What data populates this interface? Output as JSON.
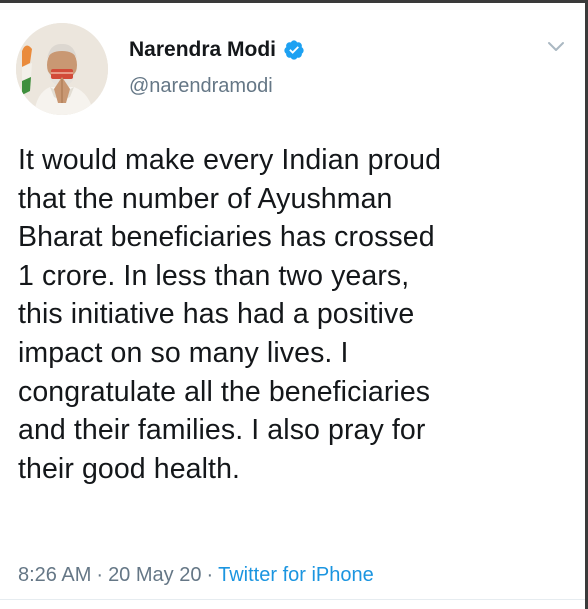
{
  "tweet": {
    "author": {
      "display_name": "Narendra Modi",
      "handle": "@narendramodi",
      "verified": true
    },
    "text": "It would make every Indian proud\nthat the number of Ayushman\nBharat beneficiaries has crossed\n1 crore. In less than two years,\nthis initiative has had a positive\nimpact on so many lives. I\ncongratulate all the beneficiaries\nand their families. I also pray for\ntheir good health.",
    "time": "8:26 AM",
    "separator": "·",
    "date": "20 May 20",
    "source": "Twitter for iPhone"
  },
  "colors": {
    "text_primary": "#14171a",
    "text_secondary": "#657786",
    "link": "#1b95e0",
    "verified_badge": "#1da1f2"
  },
  "icons": {
    "verified": "verified-badge-icon",
    "menu": "chevron-down-icon"
  }
}
